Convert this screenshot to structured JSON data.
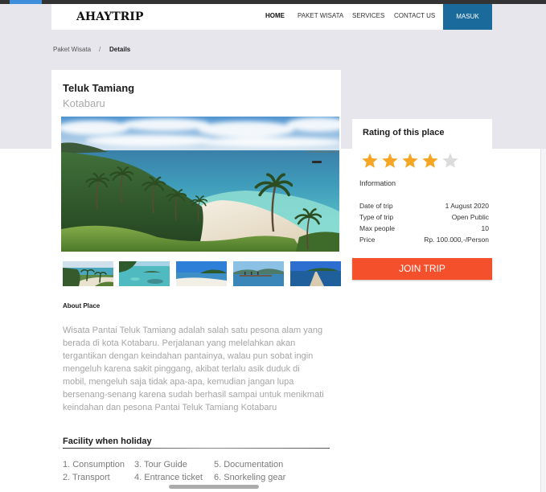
{
  "colors": {
    "topbar_accent": "#3d8edb",
    "brand_blue": "#1b6a9c",
    "join_button": "#f4502b",
    "star_filled": "#f6a623",
    "star_empty": "#dcdcdc"
  },
  "header": {
    "logo": "AHAYTRIP",
    "nav": [
      {
        "label": "HOME",
        "active": true
      },
      {
        "label": "PAKET WISATA",
        "active": false
      },
      {
        "label": "SERVICES",
        "active": false
      },
      {
        "label": "CONTACT US",
        "active": false
      }
    ],
    "login_label": "MASUK"
  },
  "breadcrumb": {
    "parent": "Paket Wisata",
    "separator": "/",
    "current": "Details"
  },
  "place": {
    "title": "Teluk Tamiang",
    "location": "Kotabaru"
  },
  "about": {
    "heading": "About Place",
    "lines": [
      "Wisata Pantai Teluk Tamiang adalah salah satu pesona alam yang",
      "berada di kota Kotabaru. Perjalanan yang melelahkan akan",
      "tergantikan dengan keindahan pantainya, walau pun sobat ingin",
      "mengeluh karena sakit pinggang, akibat terlalu asik duduk di",
      "mobil, mengeluh saja tidak apa-apa, kemudian jangan lupa",
      "bersenang-senang karena sudah berhasil sampai untuk menikmati",
      "keindahan dan pesona Pantai Teluk Tamiang Kotabaru"
    ]
  },
  "facilities": {
    "heading": "Facility when holiday",
    "items": [
      "1. Consumption",
      "2. Transport",
      "3. Tour Guide",
      "4. Entrance ticket",
      "5. Documentation",
      "6. Snorkeling gear"
    ]
  },
  "rating": {
    "heading": "Rating of this place",
    "value": 4,
    "max": 5,
    "info_heading": "Information",
    "rows": [
      {
        "label": "Date of trip",
        "value": "1 August 2020"
      },
      {
        "label": "Type of trip",
        "value": "Open Public"
      },
      {
        "label": "Max people",
        "value": "10"
      },
      {
        "label": "Price",
        "value": "Rp. 100.000,-/Person"
      }
    ]
  },
  "join": {
    "label": "JOIN TRIP"
  }
}
